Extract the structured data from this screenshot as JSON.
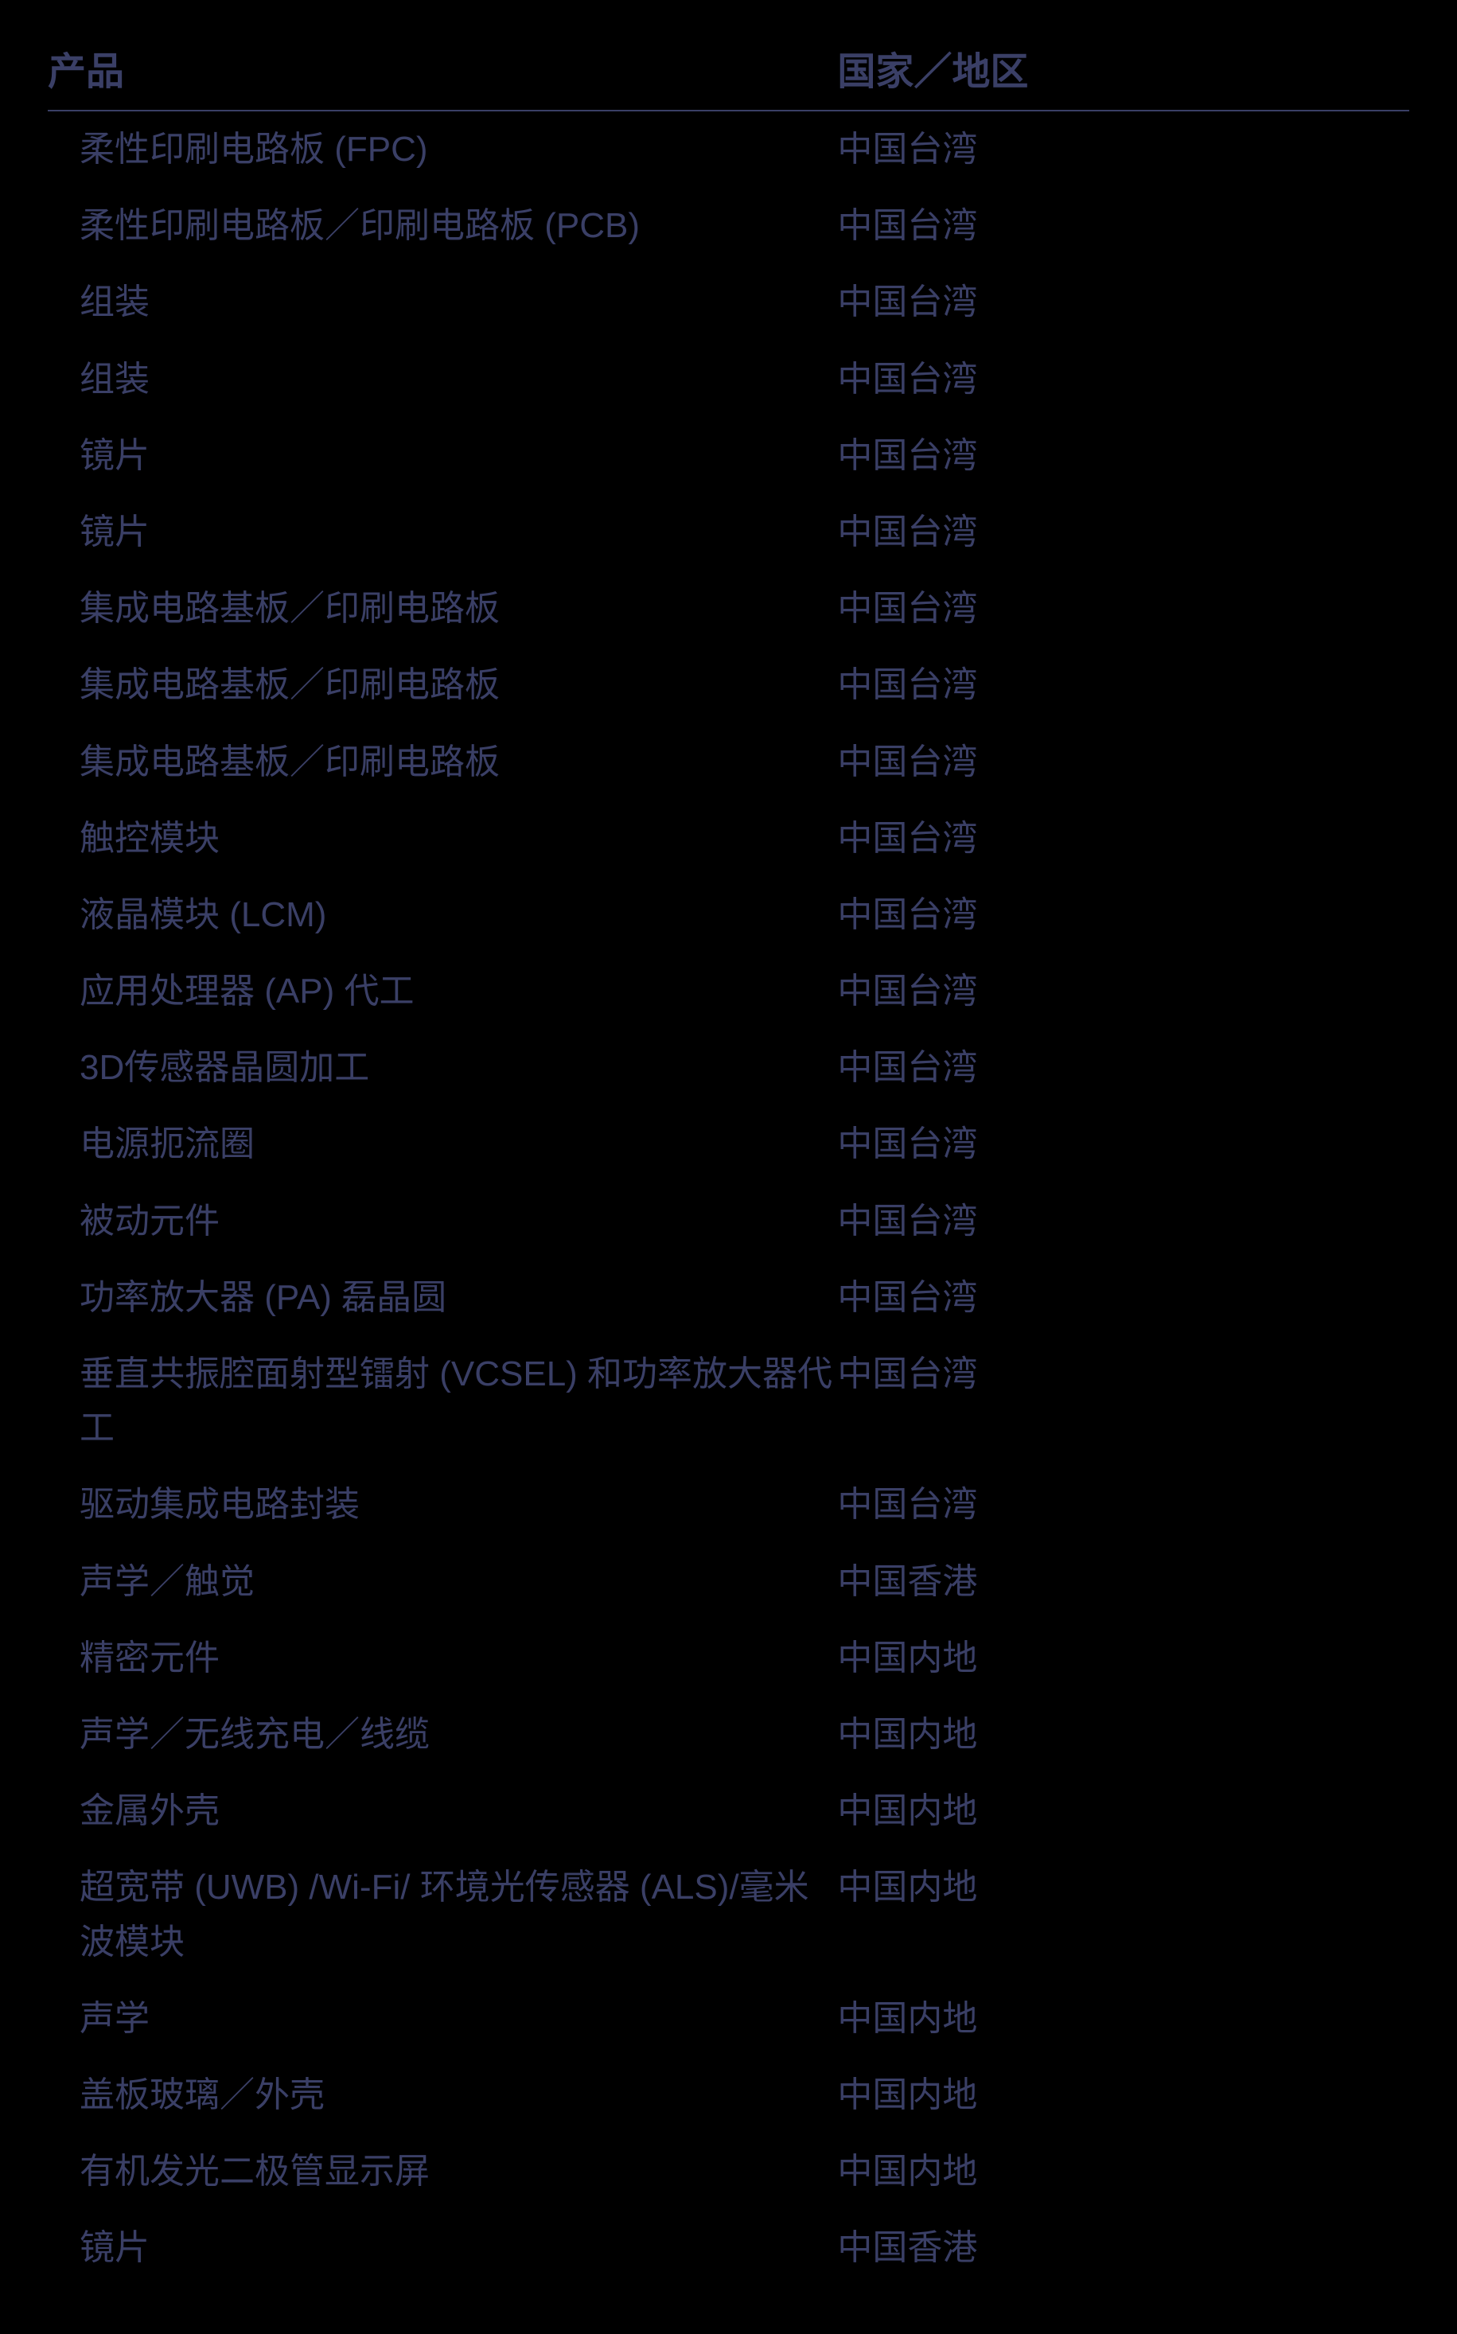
{
  "headers": {
    "product": "产品",
    "region": "国家／地区"
  },
  "rows": [
    {
      "product": "柔性印刷电路板 (FPC)",
      "region": "中国台湾"
    },
    {
      "product": "柔性印刷电路板／印刷电路板 (PCB)",
      "region": "中国台湾"
    },
    {
      "product": "组装",
      "region": "中国台湾"
    },
    {
      "product": "组装",
      "region": "中国台湾"
    },
    {
      "product": "镜片",
      "region": "中国台湾"
    },
    {
      "product": "镜片",
      "region": "中国台湾"
    },
    {
      "product": "集成电路基板／印刷电路板",
      "region": "中国台湾"
    },
    {
      "product": "集成电路基板／印刷电路板",
      "region": "中国台湾"
    },
    {
      "product": "集成电路基板／印刷电路板",
      "region": "中国台湾"
    },
    {
      "product": "触控模块",
      "region": "中国台湾"
    },
    {
      "product": "液晶模块 (LCM)",
      "region": "中国台湾"
    },
    {
      "product": "应用处理器 (AP) 代工",
      "region": "中国台湾"
    },
    {
      "product": "3D传感器晶圆加工",
      "region": "中国台湾"
    },
    {
      "product": "电源扼流圈",
      "region": "中国台湾"
    },
    {
      "product": "被动元件",
      "region": "中国台湾"
    },
    {
      "product": "功率放大器 (PA) 磊晶圆",
      "region": "中国台湾"
    },
    {
      "product": "垂直共振腔面射型镭射 (VCSEL) 和功率放大器代工",
      "region": "中国台湾"
    },
    {
      "product": "驱动集成电路封装",
      "region": "中国台湾"
    },
    {
      "product": "声学／触觉",
      "region": "中国香港"
    },
    {
      "product": "精密元件",
      "region": "中国内地"
    },
    {
      "product": "声学／无线充电／线缆",
      "region": "中国内地"
    },
    {
      "product": "金属外壳",
      "region": "中国内地"
    },
    {
      "product": "超宽带 (UWB) /Wi-Fi/ 环境光传感器 (ALS)/毫米波模块",
      "region": "中国内地"
    },
    {
      "product": "声学",
      "region": "中国内地"
    },
    {
      "product": "盖板玻璃／外壳",
      "region": "中国内地"
    },
    {
      "product": "有机发光二极管显示屏",
      "region": "中国内地"
    },
    {
      "product": "镜片",
      "region": "中国香港"
    }
  ]
}
